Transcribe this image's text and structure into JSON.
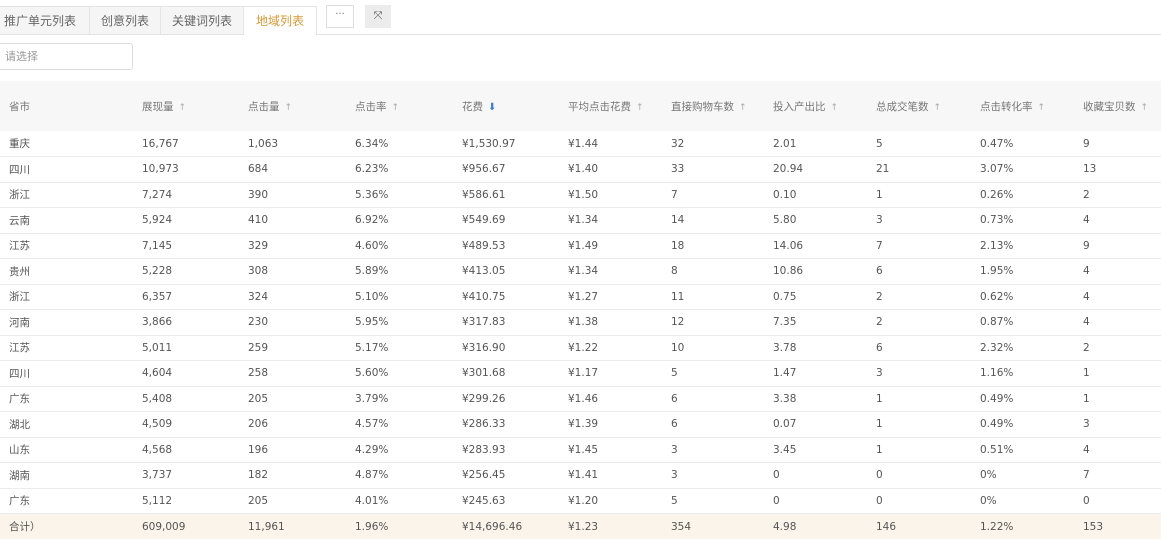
{
  "tabs": [
    {
      "label": "推广单元列表",
      "active": false
    },
    {
      "label": "创意列表",
      "active": false
    },
    {
      "label": "关键词列表",
      "active": false
    },
    {
      "label": "地域列表",
      "active": true
    }
  ],
  "tab_more_label": "···",
  "tab_expand_label": "⤧",
  "select": {
    "placeholder": "请选择"
  },
  "table": {
    "headers": [
      {
        "label": "省市",
        "sort": "none"
      },
      {
        "label": "展现量",
        "sort": "up"
      },
      {
        "label": "点击量",
        "sort": "up"
      },
      {
        "label": "点击率",
        "sort": "up"
      },
      {
        "label": "花费",
        "sort": "active-down"
      },
      {
        "label": "平均点击花费",
        "sort": "up"
      },
      {
        "label": "直接购物车数",
        "sort": "up"
      },
      {
        "label": "投入产出比",
        "sort": "up"
      },
      {
        "label": "总成交笔数",
        "sort": "up"
      },
      {
        "label": "点击转化率",
        "sort": "up"
      },
      {
        "label": "收藏宝贝数",
        "sort": "up"
      }
    ],
    "rows": [
      [
        "重庆",
        "16,767",
        "1,063",
        "6.34%",
        "¥1,530.97",
        "¥1.44",
        "32",
        "2.01",
        "5",
        "0.47%",
        "9"
      ],
      [
        "四川",
        "10,973",
        "684",
        "6.23%",
        "¥956.67",
        "¥1.40",
        "33",
        "20.94",
        "21",
        "3.07%",
        "13"
      ],
      [
        "浙江",
        "7,274",
        "390",
        "5.36%",
        "¥586.61",
        "¥1.50",
        "7",
        "0.10",
        "1",
        "0.26%",
        "2"
      ],
      [
        "云南",
        "5,924",
        "410",
        "6.92%",
        "¥549.69",
        "¥1.34",
        "14",
        "5.80",
        "3",
        "0.73%",
        "4"
      ],
      [
        "江苏",
        "7,145",
        "329",
        "4.60%",
        "¥489.53",
        "¥1.49",
        "18",
        "14.06",
        "7",
        "2.13%",
        "9"
      ],
      [
        "贵州",
        "5,228",
        "308",
        "5.89%",
        "¥413.05",
        "¥1.34",
        "8",
        "10.86",
        "6",
        "1.95%",
        "4"
      ],
      [
        "浙江",
        "6,357",
        "324",
        "5.10%",
        "¥410.75",
        "¥1.27",
        "11",
        "0.75",
        "2",
        "0.62%",
        "4"
      ],
      [
        "河南",
        "3,866",
        "230",
        "5.95%",
        "¥317.83",
        "¥1.38",
        "12",
        "7.35",
        "2",
        "0.87%",
        "4"
      ],
      [
        "江苏",
        "5,011",
        "259",
        "5.17%",
        "¥316.90",
        "¥1.22",
        "10",
        "3.78",
        "6",
        "2.32%",
        "2"
      ],
      [
        "四川",
        "4,604",
        "258",
        "5.60%",
        "¥301.68",
        "¥1.17",
        "5",
        "1.47",
        "3",
        "1.16%",
        "1"
      ],
      [
        "广东",
        "5,408",
        "205",
        "3.79%",
        "¥299.26",
        "¥1.46",
        "6",
        "3.38",
        "1",
        "0.49%",
        "1"
      ],
      [
        "湖北",
        "4,509",
        "206",
        "4.57%",
        "¥286.33",
        "¥1.39",
        "6",
        "0.07",
        "1",
        "0.49%",
        "3"
      ],
      [
        "山东",
        "4,568",
        "196",
        "4.29%",
        "¥283.93",
        "¥1.45",
        "3",
        "3.45",
        "1",
        "0.51%",
        "4"
      ],
      [
        "湖南",
        "3,737",
        "182",
        "4.87%",
        "¥256.45",
        "¥1.41",
        "3",
        "0",
        "0",
        "0%",
        "7"
      ],
      [
        "广东",
        "5,112",
        "205",
        "4.01%",
        "¥245.63",
        "¥1.20",
        "5",
        "0",
        "0",
        "0%",
        "0"
      ]
    ],
    "total": [
      "合计）",
      "609,009",
      "11,961",
      "1.96%",
      "¥14,696.46",
      "¥1.23",
      "354",
      "4.98",
      "146",
      "1.22%",
      "153"
    ]
  }
}
